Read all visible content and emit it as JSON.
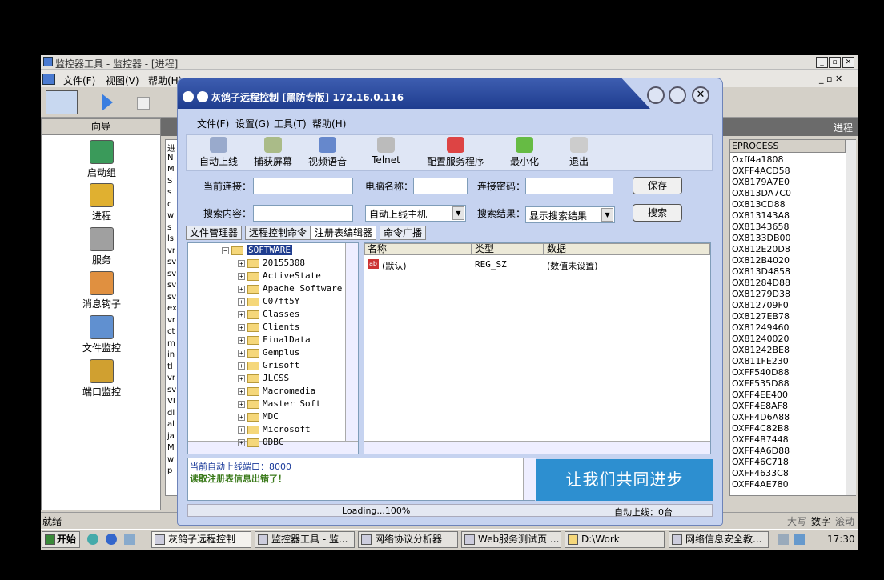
{
  "bg_window": {
    "title": "监控器工具 - 监控器 - [进程]",
    "menu": [
      "文件(F)",
      "视图(V)",
      "帮助(H)"
    ],
    "nav_header": "向导",
    "nav_items": [
      "启动组",
      "进程",
      "服务",
      "消息钩子",
      "文件监控",
      "端口监控"
    ],
    "tab_right": "进程",
    "list_header": "EPROCESS",
    "list_rows": [
      "Oxff4a1808",
      "OXFF4ACD58",
      "OX8179A7E0",
      "OX813DA7C0",
      "OX813CD88",
      "OX813143A8",
      "OX81343658",
      "OX8133DB00",
      "OX812E20D8",
      "OX812B4020",
      "OX813D4858",
      "OX81284D88",
      "OX81279D38",
      "OX812709F0",
      "OX8127EB78",
      "OX81249460",
      "OX81240020",
      "OX81242BE8",
      "OX811FE230",
      "OXFF540D88",
      "OXFF535D88",
      "OXFF4EE400",
      "OXFF4E8AF8",
      "OXFF4D6A88",
      "OXFF4C82B8",
      "OXFF4B7448",
      "OXFF4A6D88",
      "OXFF46C718",
      "OXFF4633C8",
      "OXFF4AE780"
    ],
    "left_strip": [
      "进",
      "N",
      "M",
      "S",
      "s",
      "c",
      "w",
      "s",
      "ls",
      "vr",
      "sv",
      "sv",
      "sv",
      "sv",
      "ex",
      "vr",
      "ct",
      "m",
      "in",
      "tl",
      "vr",
      "sv",
      "VI",
      "dl",
      "al",
      "ja",
      "M",
      "w",
      "p"
    ],
    "status_left": "就绪",
    "status_right": [
      "大写",
      "数字",
      "滚动"
    ]
  },
  "taskbar": {
    "start": "开始",
    "items": [
      "灰鸽子远程控制",
      "监控器工具 - 监...",
      "网络协议分析器",
      "Web服务测试页 ...",
      "D:\\Work",
      "网络信息安全教..."
    ],
    "time": "17:30"
  },
  "dialog": {
    "title": "灰鸽子远程控制  [黑防专版]    172.16.0.116",
    "menu": [
      "文件(F)",
      "设置(G)",
      "工具(T)",
      "帮助(H)"
    ],
    "tools": [
      "自动上线",
      "捕获屏幕",
      "视频语音",
      "Telnet",
      "配置服务程序",
      "最小化",
      "退出"
    ],
    "conn_label": "当前连接：",
    "pc_label": "电脑名称：",
    "pwd_label": "连接密码：",
    "save_btn": "保存",
    "search_label": "搜索内容：",
    "search_scope": "自动上线主机",
    "result_label": "搜索结果：",
    "result_value": "显示搜索结果",
    "search_btn": "搜索",
    "tabs": [
      "文件管理器",
      "远程控制命令",
      "注册表编辑器",
      "命令广播"
    ],
    "tree_root": "SOFTWARE",
    "tree_items": [
      "20155308",
      "ActiveState",
      "Apache Software",
      "C07ft5Y",
      "Classes",
      "Clients",
      "FinalData",
      "Gemplus",
      "Grisoft",
      "JLCSS",
      "Macromedia",
      "Master Soft",
      "MDC",
      "Microsoft",
      "ODBC"
    ],
    "reg_columns": [
      "名称",
      "类型",
      "数据"
    ],
    "reg_row": {
      "name": "(默认)",
      "type": "REG_SZ",
      "data": "(数值未设置)"
    },
    "log_line1": "当前自动上线端口：8000",
    "log_line2": "读取注册表信息出错了！",
    "banner": "让我们共同进步",
    "status_load": "Loading...100%",
    "status_online": "自动上线：0台"
  }
}
